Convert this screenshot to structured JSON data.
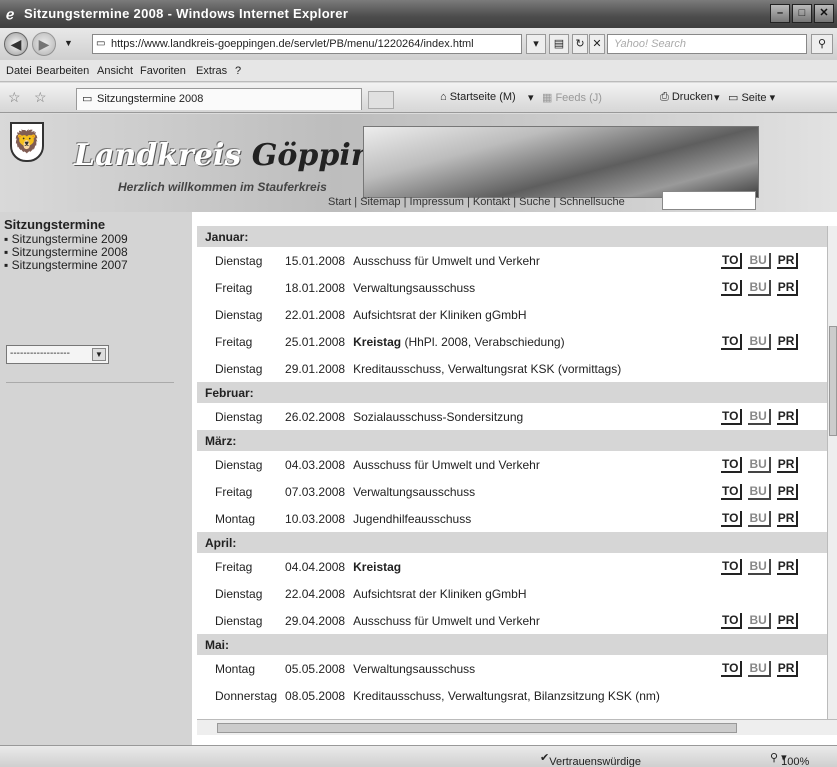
{
  "window": {
    "title": "Sitzungstermine 2008 - Windows Internet Explorer"
  },
  "address": {
    "url": "https://www.landkreis-goeppingen.de/servlet/PB/menu/1220264/index.html",
    "search_placeholder": "Yahoo! Search"
  },
  "menu": [
    "Datei",
    "Bearbeiten",
    "Ansicht",
    "Favoriten",
    "Extras",
    "?"
  ],
  "tab": {
    "label": "Sitzungstermine 2008"
  },
  "commands": {
    "home": "Startseite (M)",
    "feeds": "Feeds (J)",
    "print": "Drucken",
    "page": "Seite"
  },
  "site": {
    "brand_a": "Landkreis",
    "brand_b": "Göppingen",
    "welcome": "Herzlich willkommen im Stauferkreis",
    "toplinks": "Start | Sitemap | Impressum | Kontakt | Suche | Schnellsuche"
  },
  "sidebar": {
    "heading": "Sitzungstermine",
    "links": [
      "Sitzungstermine 2009",
      "Sitzungstermine 2008",
      "Sitzungstermine 2007"
    ],
    "select_value": "------------------"
  },
  "schedule": [
    {
      "month": "Januar:",
      "events": [
        {
          "day": "Dienstag",
          "date": "15.01.2008",
          "title": "Ausschuss für Umwelt und Verkehr",
          "bold": false,
          "docs": true,
          "pr_gray": false
        },
        {
          "day": "Freitag",
          "date": "18.01.2008",
          "title": "Verwaltungsausschuss",
          "bold": false,
          "docs": true,
          "pr_gray": false
        },
        {
          "day": "Dienstag",
          "date": "22.01.2008",
          "title": "Aufsichtsrat der Kliniken gGmbH",
          "bold": false,
          "docs": false
        },
        {
          "day": "Freitag",
          "date": "25.01.2008",
          "title": "Kreistag",
          "suffix": " (HhPl. 2008, Verabschiedung)",
          "bold": true,
          "docs": true,
          "pr_gray": false
        },
        {
          "day": "Dienstag",
          "date": "29.01.2008",
          "title": "Kreditausschuss, Verwaltungsrat KSK (vormittags)",
          "bold": false,
          "docs": false
        }
      ]
    },
    {
      "month": "Februar:",
      "events": [
        {
          "day": "Dienstag",
          "date": "26.02.2008",
          "title": "Sozialausschuss-Sondersitzung",
          "bold": false,
          "docs": true,
          "pr_gray": false
        }
      ]
    },
    {
      "month": "März:",
      "events": [
        {
          "day": "Dienstag",
          "date": "04.03.2008",
          "title": "Ausschuss für Umwelt und Verkehr",
          "bold": false,
          "docs": true,
          "pr_gray": false
        },
        {
          "day": "Freitag",
          "date": "07.03.2008",
          "title": "Verwaltungsausschuss",
          "bold": false,
          "docs": true,
          "pr_gray": false
        },
        {
          "day": "Montag",
          "date": "10.03.2008",
          "title": "Jugendhilfeausschuss",
          "bold": false,
          "docs": true,
          "pr_gray": false
        }
      ]
    },
    {
      "month": "April:",
      "events": [
        {
          "day": "Freitag",
          "date": "04.04.2008",
          "title": "Kreistag",
          "bold": true,
          "docs": true,
          "pr_gray": false
        },
        {
          "day": "Dienstag",
          "date": "22.04.2008",
          "title": "Aufsichtsrat der Kliniken gGmbH",
          "bold": false,
          "docs": false
        },
        {
          "day": "Dienstag",
          "date": "29.04.2008",
          "title": "Ausschuss für Umwelt und Verkehr",
          "bold": false,
          "docs": true,
          "pr_gray": false
        }
      ]
    },
    {
      "month": "Mai:",
      "events": [
        {
          "day": "Montag",
          "date": "05.05.2008",
          "title": "Verwaltungsausschuss",
          "bold": false,
          "docs": true,
          "pr_gray": false
        },
        {
          "day": "Donnerstag",
          "date": "08.05.2008",
          "title": "Kreditausschuss, Verwaltungsrat, Bilanzsitzung KSK (nm)",
          "bold": false,
          "docs": false
        }
      ]
    }
  ],
  "doc_labels": {
    "to": "TO",
    "bu": "BU",
    "pr": "PR"
  },
  "status": {
    "zone": "Vertrauenswürdige Sites",
    "zoom": "100%"
  }
}
